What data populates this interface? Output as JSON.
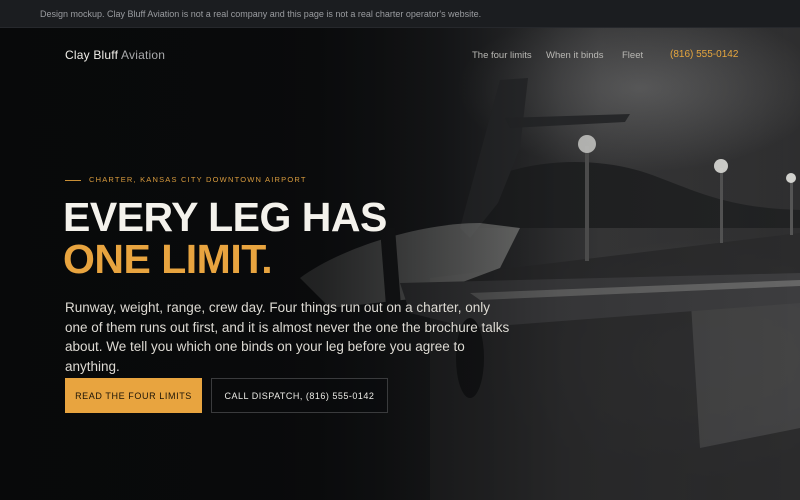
{
  "disclaimer": "Design mockup. Clay Bluff Aviation is not a real company and this page is not a real charter operator's website.",
  "nav": {
    "brand_strong": "Clay Bluff",
    "brand_light": "Aviation",
    "links": [
      "The four limits",
      "When it binds",
      "Fleet"
    ],
    "phone": "(816) 555-0142"
  },
  "hero": {
    "eyebrow": "CHARTER, KANSAS CITY DOWNTOWN AIRPORT",
    "headline_line1": "EVERY LEG HAS",
    "headline_line2": "ONE LIMIT.",
    "lede": "Runway, weight, range, crew day. Four things run out on a charter, only one of them runs out first, and it is almost never the one the brochure talks about. We tell you which one binds on your leg before you agree to anything.",
    "cta_primary": "READ THE FOUR LIMITS",
    "cta_secondary": "CALL DISPATCH, (816) 555-0142"
  },
  "colors": {
    "accent": "#e8a43f",
    "background": "#0c0d0f",
    "disclaimer_bar": "#1b1d20"
  },
  "icons": [
    "airplane-photo-background",
    "runway-light-poles"
  ]
}
